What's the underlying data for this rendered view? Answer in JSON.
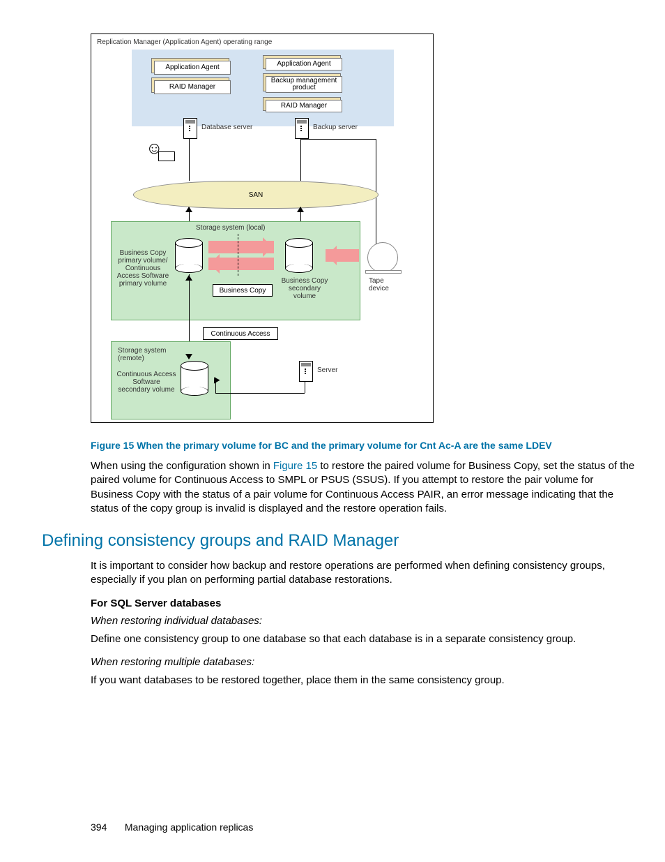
{
  "diagram": {
    "title": "Replication Manager (Application Agent) operating range",
    "left_stack": [
      "Application Agent",
      "RAID Manager"
    ],
    "right_stack": [
      "Application Agent",
      "Backup management product",
      "RAID Manager"
    ],
    "db_server": "Database server",
    "bk_server": "Backup server",
    "san": "SAN",
    "storage_local": "Storage system (local)",
    "bc_pvol": "Business Copy primary volume/ Continuous Access Software primary volume",
    "business_copy": "Business Copy",
    "bc_svol": "Business Copy secondary volume",
    "tape": "Tape device",
    "cont_access": "Continuous Access",
    "storage_remote": "Storage system (remote)",
    "ca_svol": "Continuous Access Software secondary volume",
    "server": "Server"
  },
  "caption": "Figure 15 When the primary volume for BC and the primary volume for Cnt Ac-A are the same LDEV",
  "para1a": "When using the configuration shown in ",
  "para1_link": "Figure 15",
  "para1b": " to restore the paired volume for Business Copy, set the status of the paired volume for Continuous Access to SMPL or PSUS (SSUS). If you attempt to restore the pair volume for Business Copy with the status of a pair volume for Continuous Access PAIR, an error message indicating that the status of the copy group is invalid is displayed and the restore operation fails.",
  "heading": "Defining consistency groups and RAID Manager",
  "para2": "It is important to consider how backup and restore operations are performed when defining consistency groups, especially if you plan on performing partial database restorations.",
  "sub_bold": "For SQL Server databases",
  "it1": "When restoring individual databases:",
  "p3": "Define one consistency group to one database so that each database is in a separate consistency group.",
  "it2": "When restoring multiple databases:",
  "p4": "If you want databases to be restored together, place them in the same consistency group.",
  "footer": {
    "page": "394",
    "label": "Managing application replicas"
  }
}
